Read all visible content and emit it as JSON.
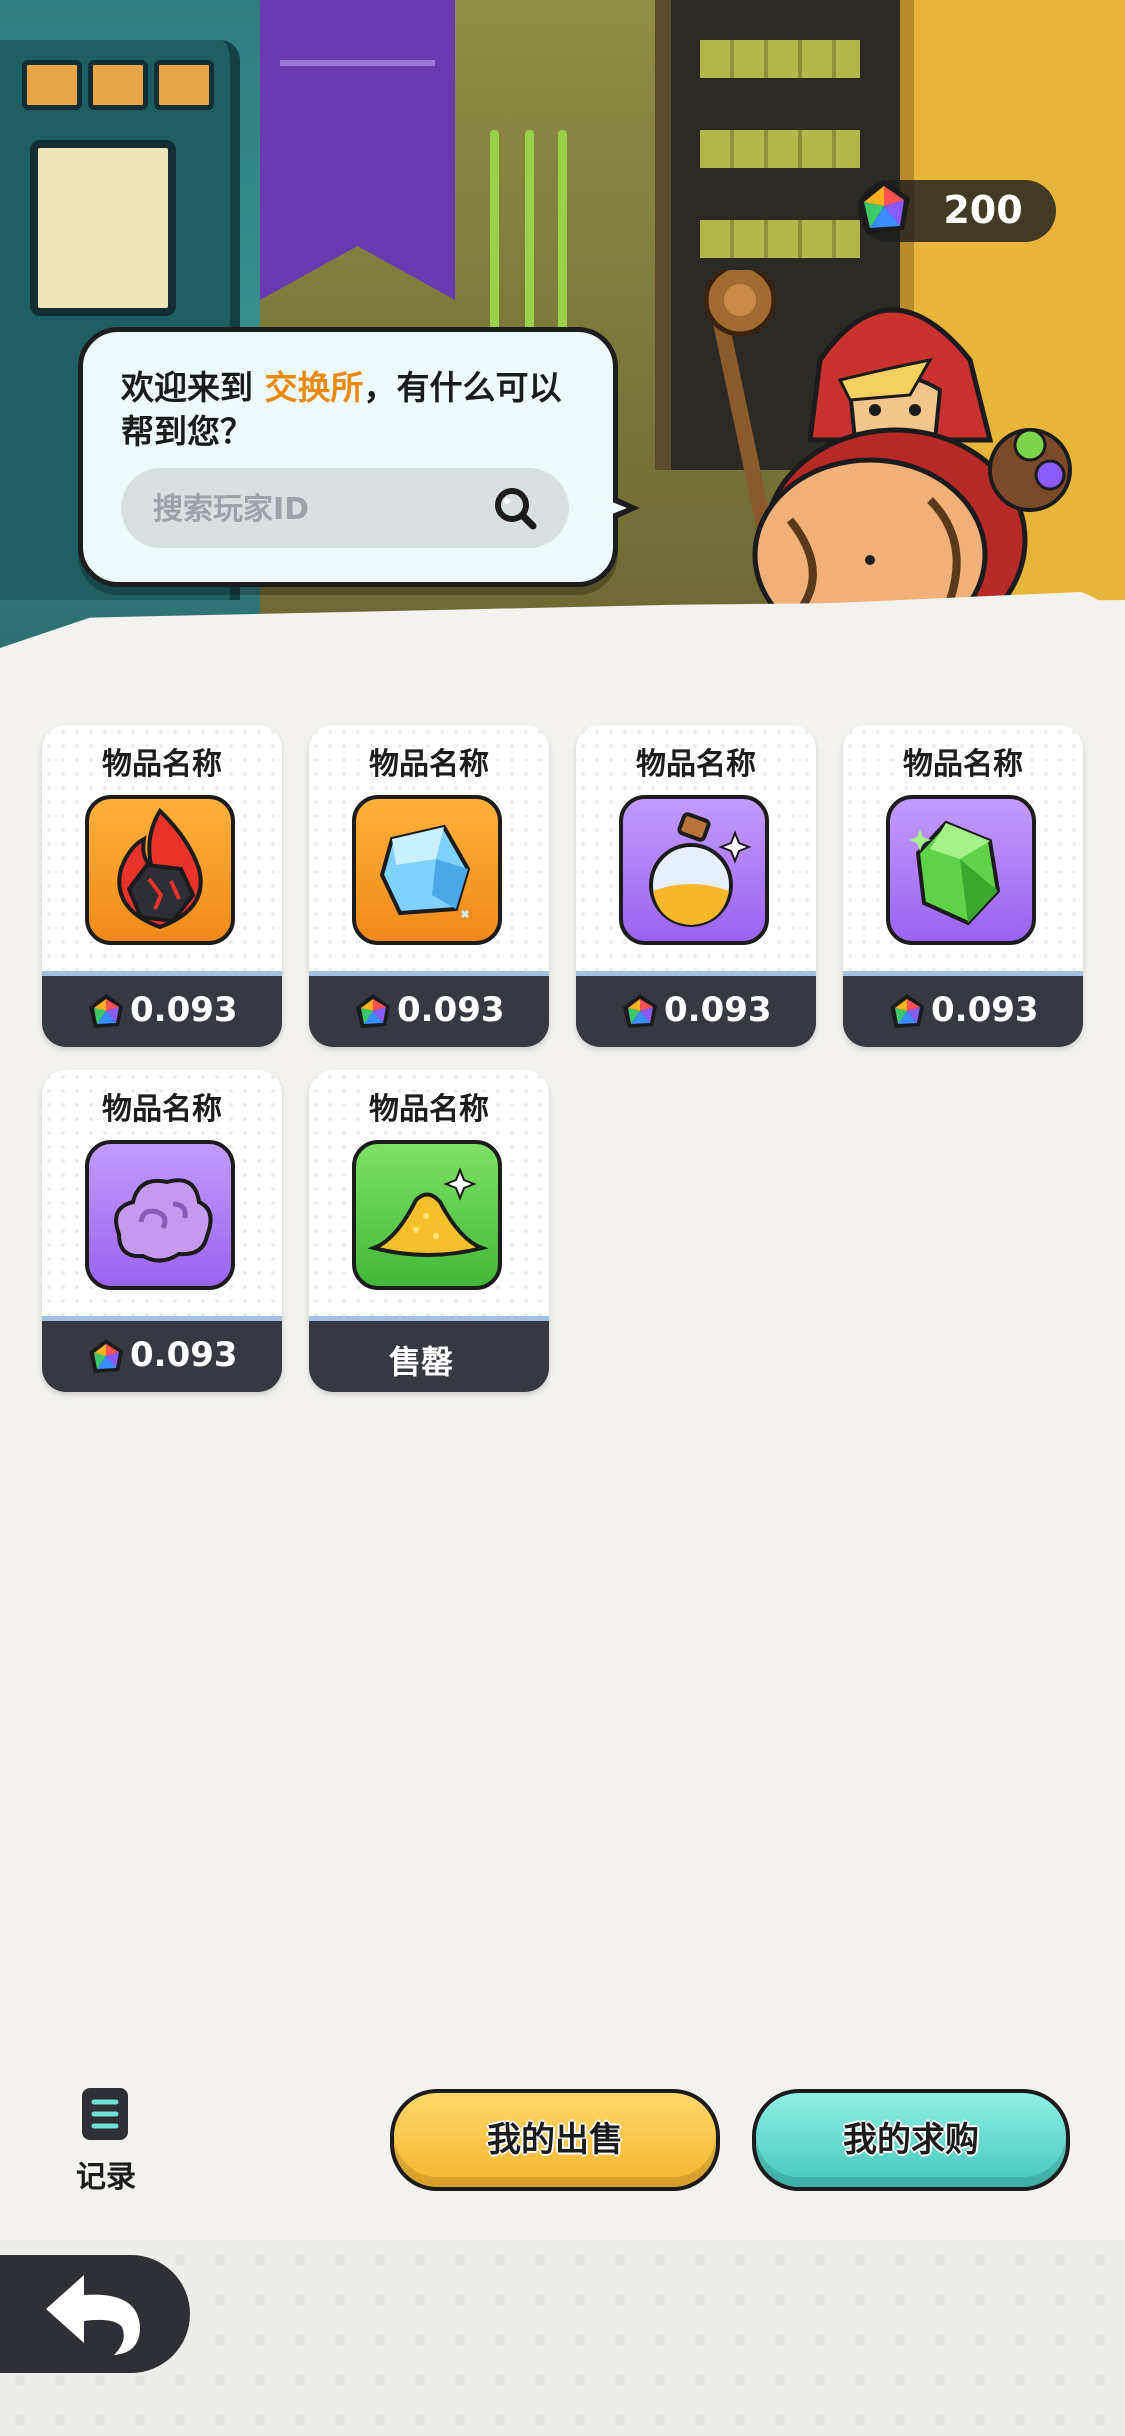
{
  "header": {
    "currency": {
      "icon": "rainbow-gem-icon",
      "value": "200"
    }
  },
  "bubble": {
    "greeting_before": "欢迎来到",
    "greeting_highlight": "交换所",
    "greeting_after": "，有什么可以帮到您？",
    "search_placeholder": "搜索玩家ID",
    "search_icon": "search-icon"
  },
  "items": [
    {
      "name": "物品名称",
      "icon": "fire-ore-icon",
      "theme": "orange",
      "price": "0.093",
      "status": ""
    },
    {
      "name": "物品名称",
      "icon": "ice-crystal-icon",
      "theme": "orange",
      "price": "0.093",
      "status": ""
    },
    {
      "name": "物品名称",
      "icon": "potion-bottle-icon",
      "theme": "purple",
      "price": "0.093",
      "status": ""
    },
    {
      "name": "物品名称",
      "icon": "green-gem-icon",
      "theme": "purple",
      "price": "0.093",
      "status": ""
    },
    {
      "name": "物品名称",
      "icon": "purple-cloud-icon",
      "theme": "purple",
      "price": "0.093",
      "status": ""
    },
    {
      "name": "物品名称",
      "icon": "gold-dust-icon",
      "theme": "green",
      "price": "",
      "status": "售罄"
    }
  ],
  "bottom": {
    "records_label": "记录",
    "my_sell_label": "我的出售",
    "my_buy_label": "我的求购",
    "back_icon": "back-arrow-icon"
  },
  "colors": {
    "sell_button": "#f4b52c",
    "buy_button": "#45c6bd",
    "card_footer": "#363842",
    "highlight_text": "#e88a10"
  }
}
